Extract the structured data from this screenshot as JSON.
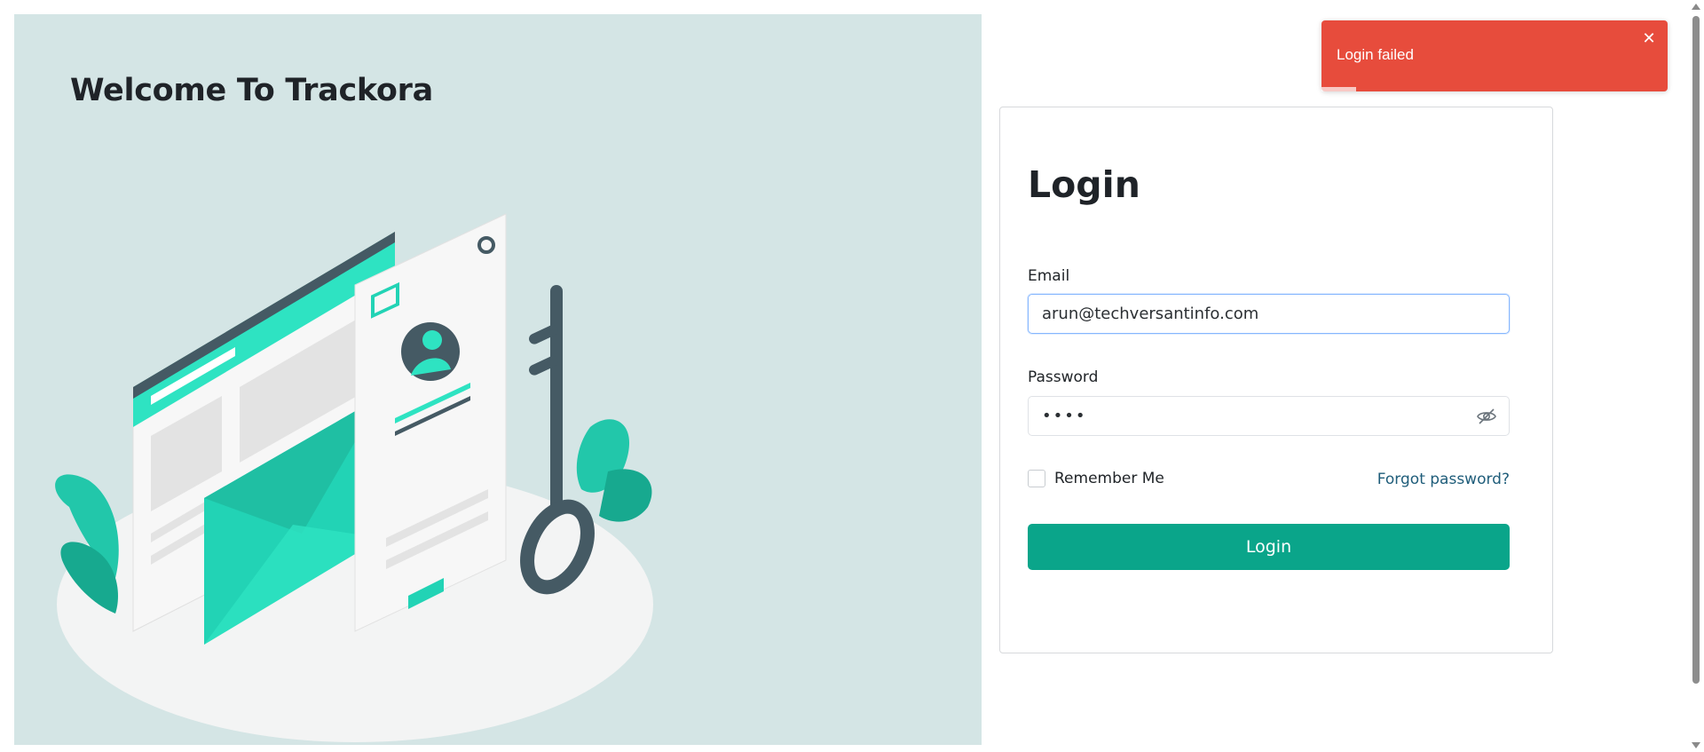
{
  "hero": {
    "title": "Welcome To Trackora",
    "background_color": "#d4e5e5",
    "illustration_icon": "login-security-illustration"
  },
  "login": {
    "title": "Login",
    "email_label": "Email",
    "email_value": "arun@techversantinfo.com",
    "password_label": "Password",
    "password_value": "••••",
    "password_toggle_icon": "eye-slash-icon",
    "remember_label": "Remember Me",
    "remember_checked": false,
    "forgot_label": "Forgot password?",
    "submit_label": "Login",
    "accent_color": "#0aa58a"
  },
  "toast": {
    "message": "Login failed",
    "close_icon": "close-icon",
    "color": "#e74c3c",
    "progress_fraction": 0.1
  }
}
